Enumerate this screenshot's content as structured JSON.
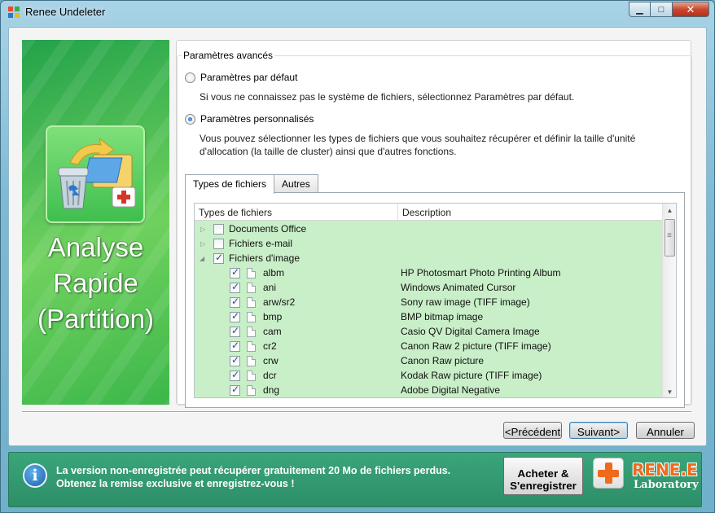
{
  "window": {
    "title": "Renee Undeleter",
    "controls": {
      "minimize": "▁",
      "maximize": "□",
      "close": "✕"
    }
  },
  "left_panel": {
    "title_lines": [
      "Analyse",
      "Rapide",
      "(Partition)"
    ],
    "icon": "recycle-bin-recovery-icon"
  },
  "advanced": {
    "legend": "Paramètres avancés",
    "default_option": {
      "label": "Paramètres par défaut",
      "selected": false,
      "description": "Si vous ne connaissez pas le système de fichiers, sélectionnez Paramètres par défaut."
    },
    "custom_option": {
      "label": "Paramètres personnalisés",
      "selected": true,
      "description_line1": "Vous pouvez sélectionner les types de fichiers que vous souhaitez récupérer et définir la taille d'unité",
      "description_line2": "d'allocation (la taille de cluster) ainsi que d'autres fonctions."
    }
  },
  "tabs": [
    {
      "label": "Types de fichiers",
      "active": true
    },
    {
      "label": "Autres",
      "active": false
    }
  ],
  "file_list": {
    "columns": [
      "Types de fichiers",
      "Description"
    ],
    "groups": [
      {
        "label": "Documents Office",
        "checked": false,
        "expanded": false
      },
      {
        "label": "Fichiers e-mail",
        "checked": false,
        "expanded": false
      },
      {
        "label": "Fichiers d'image",
        "checked": true,
        "expanded": true
      }
    ],
    "items": [
      {
        "ext": "albm",
        "desc": "HP Photosmart Photo Printing Album",
        "checked": true
      },
      {
        "ext": "ani",
        "desc": "Windows Animated Cursor",
        "checked": true
      },
      {
        "ext": "arw/sr2",
        "desc": "Sony raw image (TIFF image)",
        "checked": true
      },
      {
        "ext": "bmp",
        "desc": "BMP bitmap image",
        "checked": true
      },
      {
        "ext": "cam",
        "desc": "Casio QV Digital Camera Image",
        "checked": true
      },
      {
        "ext": "cr2",
        "desc": "Canon Raw 2 picture (TIFF image)",
        "checked": true
      },
      {
        "ext": "crw",
        "desc": "Canon Raw picture",
        "checked": true
      },
      {
        "ext": "dcr",
        "desc": "Kodak Raw picture (TIFF image)",
        "checked": true
      },
      {
        "ext": "dng",
        "desc": "Adobe Digital Negative",
        "checked": true
      }
    ],
    "row_highlight_color": "#c9efc8"
  },
  "nav_buttons": {
    "previous": "<Précédent",
    "next": "Suivant>",
    "cancel": "Annuler"
  },
  "footer": {
    "message_line1": "La version non-enregistrée peut récupérer gratuitement 20 Mo de fichiers perdus.",
    "message_line2": "Obtenez la remise exclusive et enregistrez-vous !",
    "buy_line1": "Acheter &",
    "buy_line2": "S'enregistrer",
    "brand_name": "RENE.E",
    "brand_sub": "Laboratory",
    "brand_color": "#f06a1e",
    "bar_color": "#2f9a6f"
  }
}
